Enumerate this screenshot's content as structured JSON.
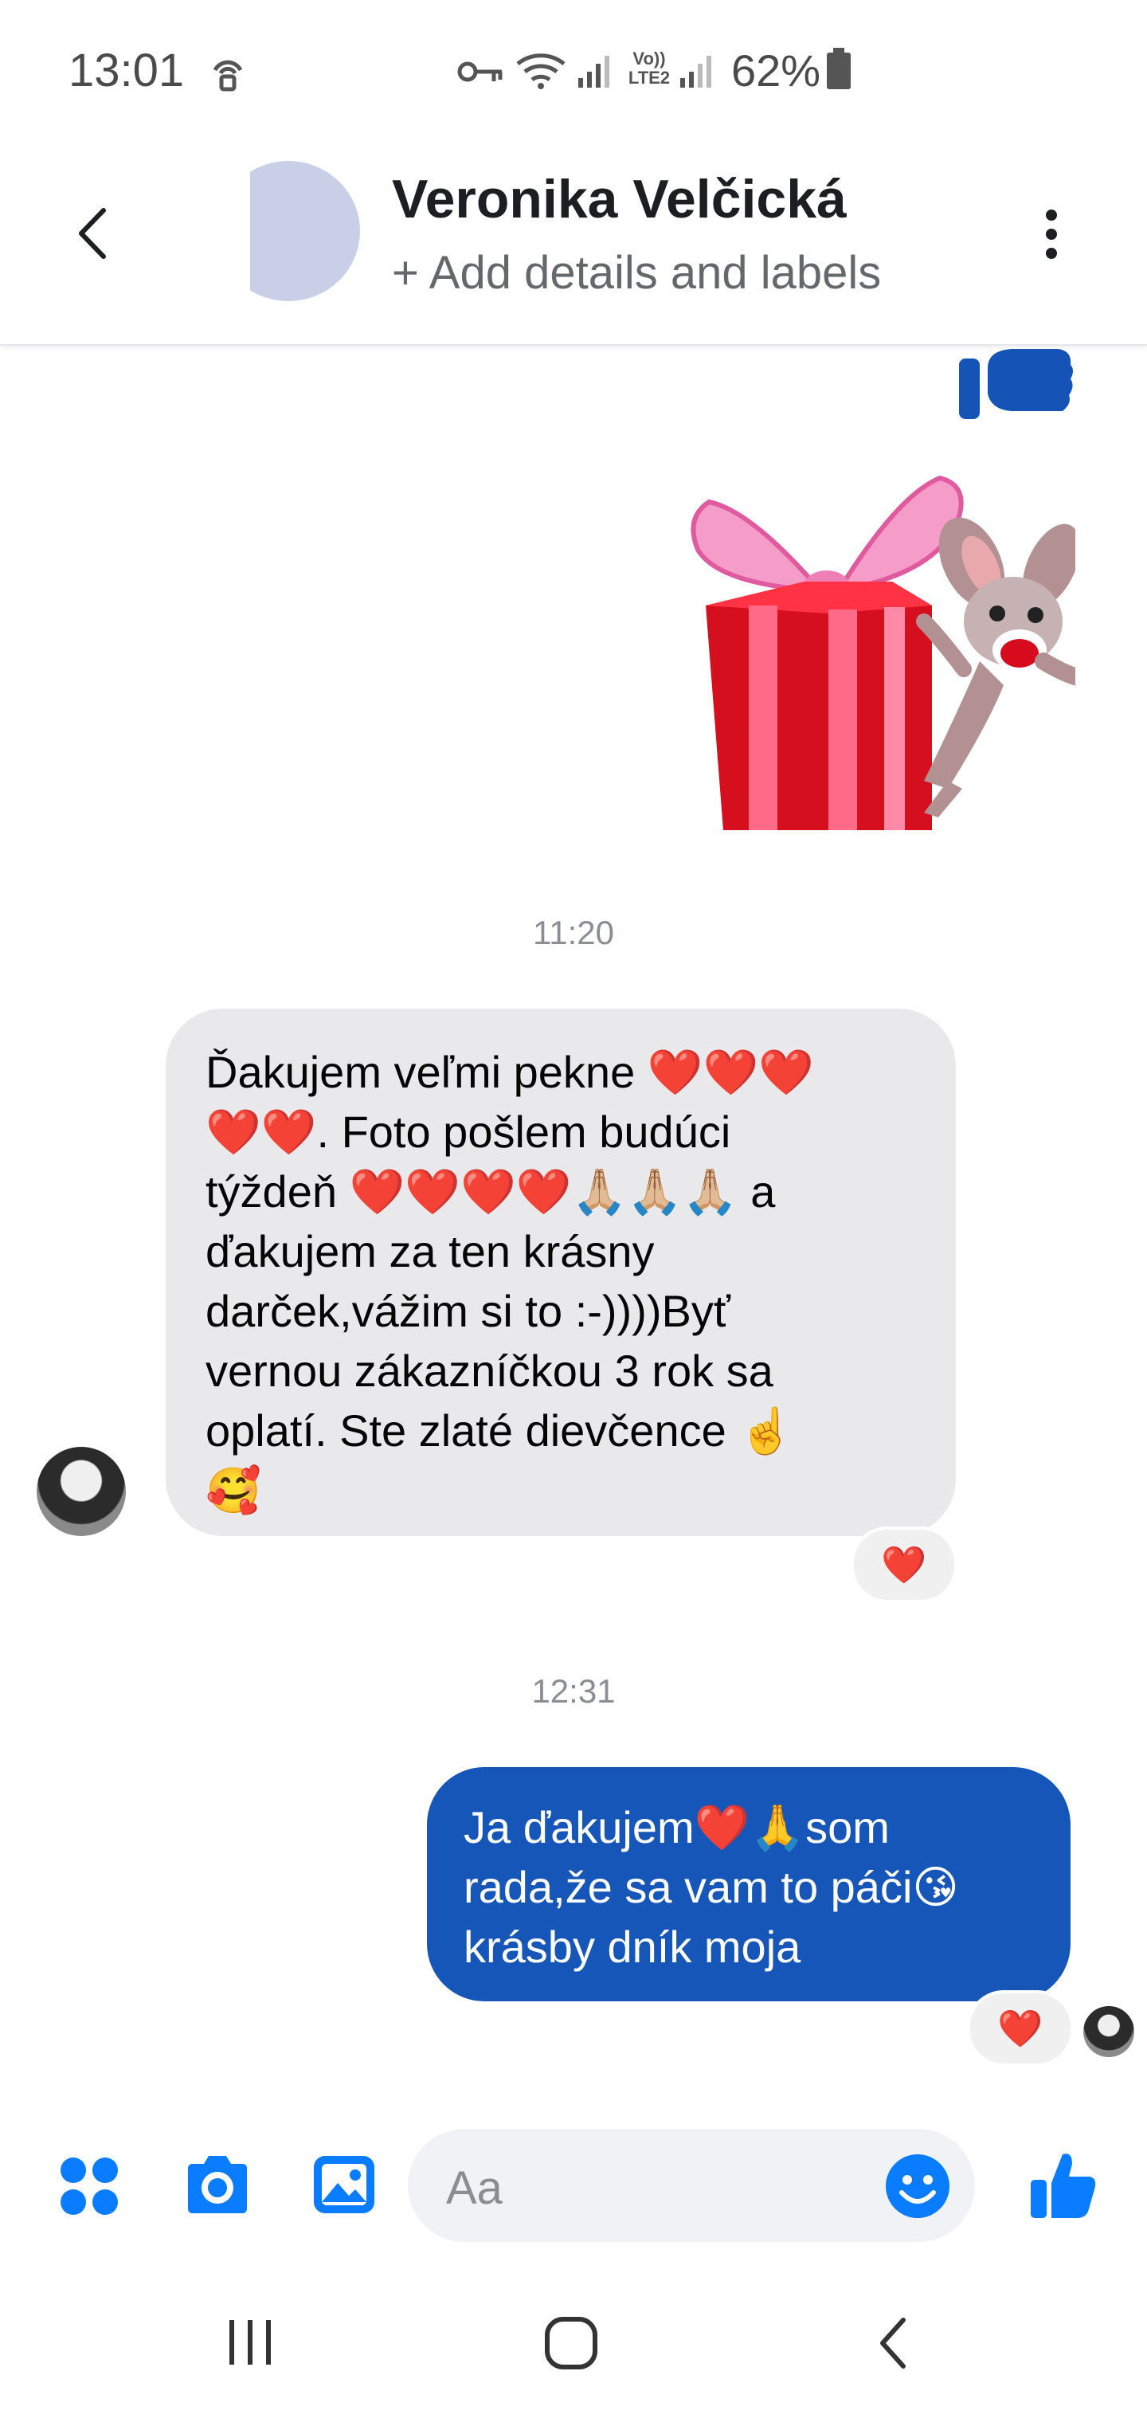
{
  "status_bar": {
    "time": "13:01",
    "network_label": "Vo)) LTE2",
    "battery": "62%",
    "icons": [
      "hotspot-icon",
      "vpn-key-icon",
      "wifi-icon",
      "signal-icon",
      "signal-icon",
      "battery-icon"
    ]
  },
  "header": {
    "contact_name": "Veronika Velčická",
    "subtitle": "+ Add details and labels",
    "icons": [
      "back-arrow-icon",
      "more-options-icon"
    ]
  },
  "conversation": {
    "messages": [
      {
        "type": "like-sticker",
        "from": "me"
      },
      {
        "type": "gift-sticker",
        "from": "me"
      },
      {
        "type": "timestamp",
        "text": "11:20"
      },
      {
        "type": "text",
        "from": "contact",
        "lines": [
          "Ďakujem veľmi pekne ❤️❤️❤️",
          "❤️❤️. Foto pošlem budúci",
          "týždeň ❤️❤️❤️❤️🙏🏼🙏🏼🙏🏼 a",
          "ďakujem za ten krásny",
          "darček,vážim si to :-))))Byť",
          "vernou zákazníčkou 3 rok sa",
          "oplatí. Ste zlaté dievčence ☝️",
          "🥰"
        ],
        "reaction": "❤️"
      },
      {
        "type": "timestamp",
        "text": "12:31"
      },
      {
        "type": "text",
        "from": "me",
        "lines": [
          "Ja ďakujem❤️🙏som",
          "rada,že sa vam to páči😘",
          "krásby dník moja"
        ],
        "reaction": "❤️"
      }
    ]
  },
  "composer": {
    "placeholder": "Aa",
    "icons": [
      "apps-grid-icon",
      "camera-icon",
      "gallery-icon",
      "emoji-icon",
      "thumbs-up-icon"
    ]
  },
  "nav_bar": {
    "icons": [
      "recent-apps-icon",
      "home-icon",
      "back-icon"
    ]
  },
  "colors": {
    "accent": "#0a7cff",
    "outgoing_bubble": "#1656b8",
    "incoming_bubble": "#e9e9eb"
  }
}
